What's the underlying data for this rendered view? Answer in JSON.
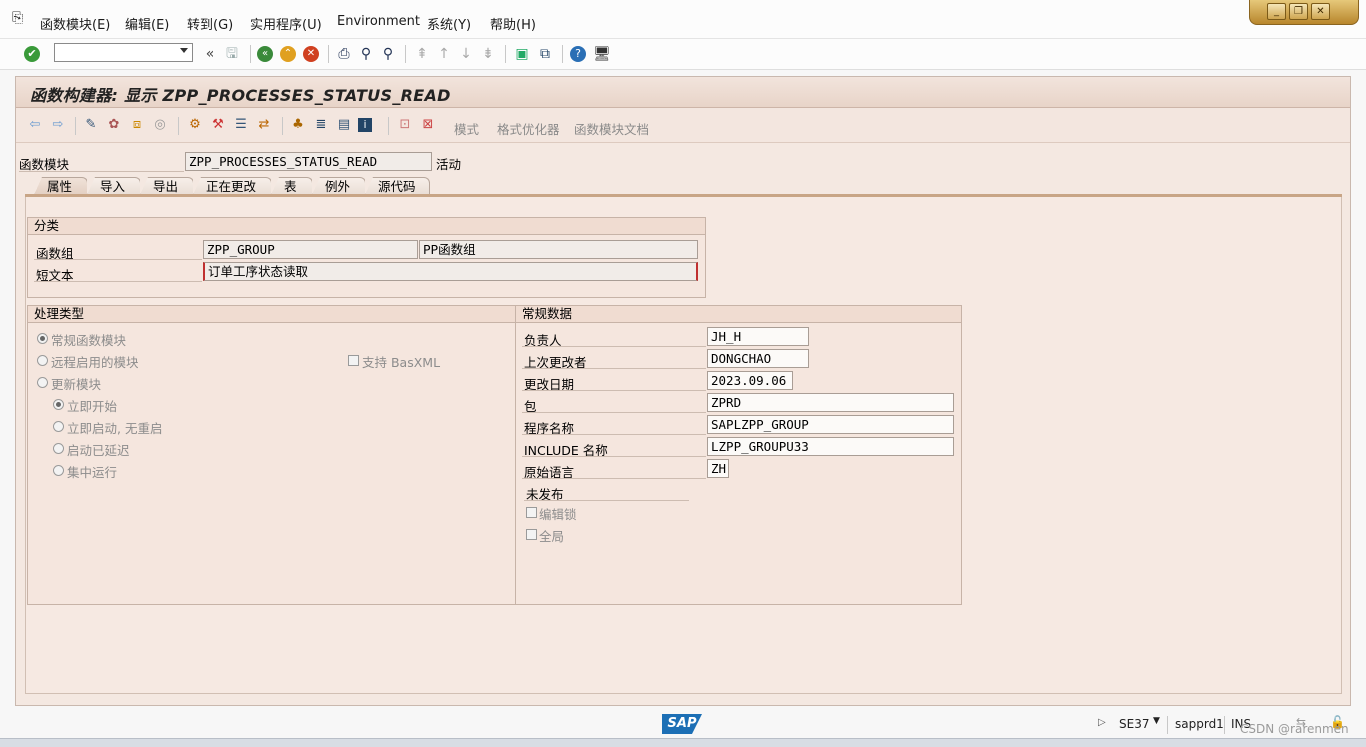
{
  "menubar": {
    "items": [
      "函数模块(E)",
      "编辑(E)",
      "转到(G)",
      "实用程序(U)",
      "Environment",
      "系统(Y)",
      "帮助(H)"
    ]
  },
  "window_controls": {
    "minimize": "_",
    "restore": "❐",
    "close": "✕"
  },
  "title": "函数构建器: 显示 ZPP_PROCESSES_STATUS_READ",
  "app_toolbar": {
    "pattern_label": "模式",
    "pretty_printer_label": "格式优化器",
    "fm_doc_label": "函数模块文档"
  },
  "header": {
    "fm_label": "函数模块",
    "fm_value": "ZPP_PROCESSES_STATUS_READ",
    "status": "活动"
  },
  "tabs": [
    "属性",
    "导入",
    "导出",
    "正在更改",
    "表",
    "例外",
    "源代码"
  ],
  "classification": {
    "title": "分类",
    "function_group_label": "函数组",
    "function_group_value": "ZPP_GROUP",
    "function_group_desc": "PP函数组",
    "short_text_label": "短文本",
    "short_text_value": "订单工序状态读取"
  },
  "processing_type": {
    "title": "处理类型",
    "options": [
      "常规函数模块",
      "远程启用的模块",
      "更新模块"
    ],
    "selected": "常规函数模块",
    "basxml_label": "支持 BasXML",
    "update_options": [
      "立即开始",
      "立即启动, 无重启",
      "启动已延迟",
      "集中运行"
    ],
    "update_selected": "立即开始"
  },
  "general_data": {
    "title": "常规数据",
    "responsible_label": "负责人",
    "responsible_value": "JH_H",
    "last_changed_by_label": "上次更改者",
    "last_changed_by_value": "DONGCHAO",
    "changed_on_label": "更改日期",
    "changed_on_value": "2023.09.06",
    "package_label": "包",
    "package_value": "ZPRD",
    "program_label": "程序名称",
    "program_value": "SAPLZPP_GROUP",
    "include_label": "INCLUDE 名称",
    "include_value": "LZPP_GROUPU33",
    "orig_lang_label": "原始语言",
    "orig_lang_value": "ZH",
    "not_released_label": "未发布",
    "edit_lock_label": "编辑锁",
    "global_label": "全局"
  },
  "statusbar": {
    "logo": "SAP",
    "transaction": "SE37",
    "server": "sapprd1",
    "mode": "INS",
    "watermark": "CSDN @rarenmen"
  }
}
